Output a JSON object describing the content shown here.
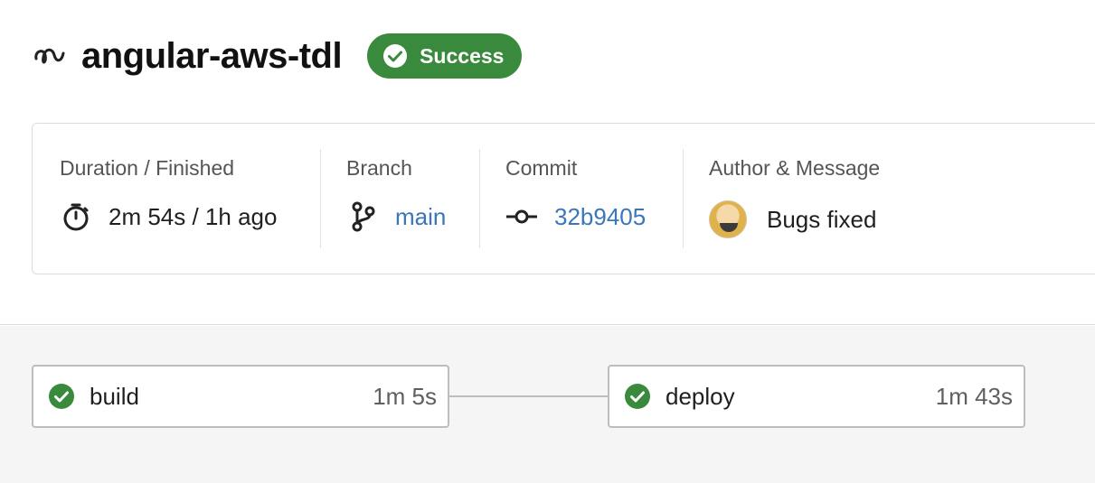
{
  "header": {
    "pipeline_name": "angular-aws-tdl",
    "status": "Success",
    "icons": {
      "pipeline": "pipeline-icon",
      "status": "check-circle-icon"
    },
    "colors": {
      "success": "#3a8a3d"
    }
  },
  "summary": {
    "duration": {
      "label": "Duration / Finished",
      "value": "2m 54s / 1h ago",
      "icon": "stopwatch-icon"
    },
    "branch": {
      "label": "Branch",
      "value": "main",
      "icon": "branch-icon"
    },
    "commit": {
      "label": "Commit",
      "value": "32b9405",
      "icon": "commit-icon"
    },
    "author": {
      "label": "Author & Message",
      "message": "Bugs fixed",
      "icon": "avatar"
    }
  },
  "jobs": [
    {
      "name": "build",
      "duration": "1m 5s",
      "status": "success"
    },
    {
      "name": "deploy",
      "duration": "1m 43s",
      "status": "success"
    }
  ]
}
